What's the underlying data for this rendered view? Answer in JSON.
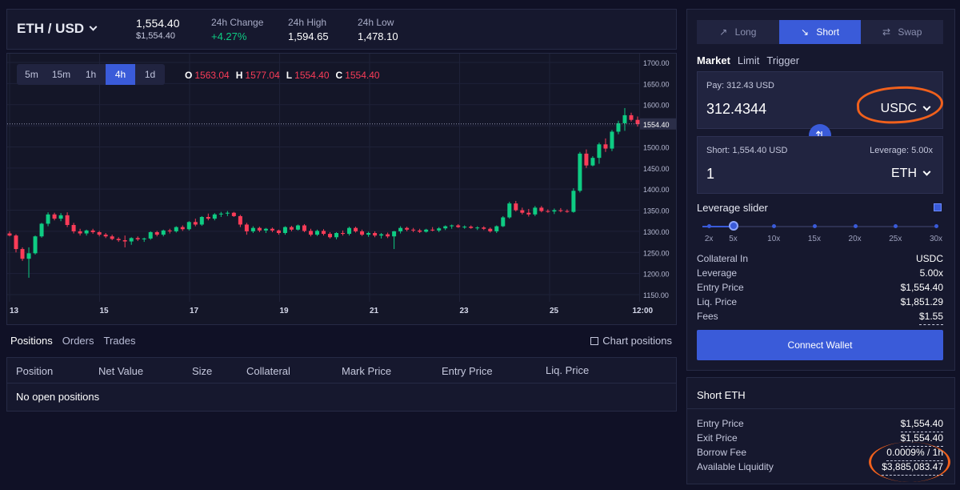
{
  "ticker": {
    "pair": "ETH / USD",
    "price": "1,554.40",
    "price_usd": "$1,554.40",
    "change_label": "24h Change",
    "change_value": "+4.27%",
    "high_label": "24h High",
    "high_value": "1,594.65",
    "low_label": "24h Low",
    "low_value": "1,478.10"
  },
  "chart": {
    "timeframes": [
      "5m",
      "15m",
      "1h",
      "4h",
      "1d"
    ],
    "active_timeframe": "4h",
    "ohlc": {
      "o": "1563.04",
      "h": "1577.04",
      "l": "1554.40",
      "c": "1554.40"
    },
    "ohlc_labels": {
      "o": "O",
      "h": "H",
      "l": "L",
      "c": "C"
    },
    "price_tag": "1554.40"
  },
  "chart_data": {
    "type": "candlestick",
    "x_labels": [
      "13",
      "15",
      "17",
      "19",
      "21",
      "23",
      "25",
      "12:00"
    ],
    "y_ticks": [
      1700,
      1650,
      1600,
      1550,
      1500,
      1450,
      1400,
      1350,
      1300,
      1250,
      1200,
      1150
    ],
    "ylim": [
      1130,
      1715
    ],
    "current_price": 1554.4,
    "colors": {
      "up": "#0ecc83",
      "down": "#fa3c58"
    },
    "candles": [
      [
        1295,
        1300,
        1288,
        1290
      ],
      [
        1290,
        1293,
        1250,
        1258
      ],
      [
        1258,
        1262,
        1230,
        1235
      ],
      [
        1235,
        1262,
        1190,
        1248
      ],
      [
        1248,
        1290,
        1245,
        1288
      ],
      [
        1288,
        1320,
        1285,
        1318
      ],
      [
        1318,
        1345,
        1312,
        1340
      ],
      [
        1340,
        1344,
        1326,
        1330
      ],
      [
        1330,
        1343,
        1324,
        1338
      ],
      [
        1338,
        1345,
        1310,
        1315
      ],
      [
        1315,
        1320,
        1295,
        1300
      ],
      [
        1300,
        1306,
        1290,
        1295
      ],
      [
        1295,
        1304,
        1290,
        1302
      ],
      [
        1302,
        1306,
        1294,
        1298
      ],
      [
        1298,
        1301,
        1288,
        1292
      ],
      [
        1292,
        1296,
        1284,
        1288
      ],
      [
        1288,
        1292,
        1279,
        1282
      ],
      [
        1282,
        1286,
        1275,
        1279
      ],
      [
        1279,
        1290,
        1262,
        1276
      ],
      [
        1276,
        1286,
        1268,
        1284
      ],
      [
        1284,
        1288,
        1277,
        1281
      ],
      [
        1281,
        1285,
        1275,
        1283
      ],
      [
        1283,
        1300,
        1280,
        1298
      ],
      [
        1298,
        1301,
        1288,
        1292
      ],
      [
        1292,
        1304,
        1288,
        1302
      ],
      [
        1302,
        1306,
        1295,
        1300
      ],
      [
        1300,
        1312,
        1297,
        1310
      ],
      [
        1310,
        1314,
        1301,
        1305
      ],
      [
        1305,
        1324,
        1302,
        1322
      ],
      [
        1322,
        1330,
        1312,
        1316
      ],
      [
        1316,
        1336,
        1313,
        1334
      ],
      [
        1334,
        1342,
        1326,
        1330
      ],
      [
        1330,
        1343,
        1326,
        1340
      ],
      [
        1340,
        1346,
        1334,
        1342
      ],
      [
        1342,
        1348,
        1336,
        1344
      ],
      [
        1344,
        1346,
        1334,
        1336
      ],
      [
        1336,
        1339,
        1310,
        1316
      ],
      [
        1316,
        1320,
        1292,
        1300
      ],
      [
        1300,
        1312,
        1296,
        1308
      ],
      [
        1308,
        1311,
        1298,
        1302
      ],
      [
        1302,
        1308,
        1296,
        1306
      ],
      [
        1306,
        1309,
        1298,
        1302
      ],
      [
        1302,
        1304,
        1292,
        1296
      ],
      [
        1296,
        1312,
        1292,
        1310
      ],
      [
        1310,
        1313,
        1300,
        1304
      ],
      [
        1304,
        1316,
        1302,
        1314
      ],
      [
        1314,
        1317,
        1298,
        1301
      ],
      [
        1301,
        1306,
        1288,
        1292
      ],
      [
        1292,
        1304,
        1289,
        1301
      ],
      [
        1301,
        1305,
        1290,
        1294
      ],
      [
        1294,
        1298,
        1283,
        1286
      ],
      [
        1286,
        1298,
        1281,
        1296
      ],
      [
        1296,
        1302,
        1290,
        1294
      ],
      [
        1294,
        1311,
        1290,
        1308
      ],
      [
        1308,
        1311,
        1297,
        1300
      ],
      [
        1300,
        1304,
        1289,
        1292
      ],
      [
        1292,
        1299,
        1287,
        1296
      ],
      [
        1296,
        1300,
        1286,
        1290
      ],
      [
        1290,
        1296,
        1283,
        1293
      ],
      [
        1293,
        1297,
        1284,
        1288
      ],
      [
        1288,
        1301,
        1258,
        1300
      ],
      [
        1300,
        1312,
        1295,
        1308
      ],
      [
        1308,
        1311,
        1300,
        1304
      ],
      [
        1304,
        1308,
        1298,
        1302
      ],
      [
        1302,
        1306,
        1296,
        1299
      ],
      [
        1299,
        1306,
        1297,
        1304
      ],
      [
        1304,
        1310,
        1300,
        1302
      ],
      [
        1302,
        1310,
        1298,
        1307
      ],
      [
        1307,
        1314,
        1303,
        1312
      ],
      [
        1312,
        1316,
        1306,
        1314
      ],
      [
        1314,
        1317,
        1308,
        1310
      ],
      [
        1310,
        1314,
        1306,
        1311
      ],
      [
        1311,
        1314,
        1306,
        1308
      ],
      [
        1308,
        1312,
        1303,
        1309
      ],
      [
        1309,
        1312,
        1303,
        1306
      ],
      [
        1306,
        1309,
        1297,
        1300
      ],
      [
        1300,
        1314,
        1296,
        1312
      ],
      [
        1312,
        1336,
        1310,
        1333
      ],
      [
        1333,
        1370,
        1330,
        1366
      ],
      [
        1366,
        1372,
        1347,
        1350
      ],
      [
        1350,
        1356,
        1340,
        1344
      ],
      [
        1344,
        1353,
        1335,
        1340
      ],
      [
        1340,
        1360,
        1336,
        1356
      ],
      [
        1356,
        1360,
        1345,
        1348
      ],
      [
        1348,
        1352,
        1344,
        1347
      ],
      [
        1347,
        1354,
        1341,
        1350
      ],
      [
        1350,
        1355,
        1345,
        1348
      ],
      [
        1348,
        1352,
        1344,
        1346
      ],
      [
        1346,
        1402,
        1344,
        1396
      ],
      [
        1396,
        1488,
        1392,
        1484
      ],
      [
        1484,
        1494,
        1450,
        1456
      ],
      [
        1456,
        1478,
        1454,
        1474
      ],
      [
        1474,
        1510,
        1460,
        1506
      ],
      [
        1506,
        1520,
        1488,
        1496
      ],
      [
        1496,
        1540,
        1490,
        1536
      ],
      [
        1536,
        1562,
        1530,
        1556
      ],
      [
        1556,
        1592,
        1538,
        1575
      ],
      [
        1575,
        1581,
        1560,
        1564
      ],
      [
        1564,
        1572,
        1548,
        1554
      ]
    ]
  },
  "positions": {
    "tabs": [
      "Positions",
      "Orders",
      "Trades"
    ],
    "chart_positions": "Chart positions",
    "columns": [
      "Position",
      "Net Value",
      "Size",
      "Collateral",
      "Mark Price",
      "Entry Price",
      "Liq. Price"
    ],
    "empty": "No open positions"
  },
  "trade": {
    "modes": [
      "Long",
      "Short",
      "Swap"
    ],
    "active_mode": "Short",
    "mode_icons": [
      "trend-up-icon",
      "trend-down-icon",
      "swap-icon"
    ],
    "order_types": [
      "Market",
      "Limit",
      "Trigger"
    ],
    "pay_label": "Pay: 312.43 USD",
    "pay_value": "312.4344",
    "pay_token": "USDC",
    "short_label": "Short: 1,554.40 USD",
    "leverage_label": "Leverage: 5.00x",
    "short_value": "1",
    "short_token": "ETH",
    "slider_label": "Leverage slider",
    "slider_ticks": [
      "2x",
      "5x",
      "10x",
      "15x",
      "20x",
      "25x",
      "30x"
    ],
    "slider_value": 5,
    "details": [
      {
        "k": "Collateral In",
        "v": "USDC"
      },
      {
        "k": "Leverage",
        "v": "5.00x"
      },
      {
        "k": "Entry Price",
        "v": "$1,554.40"
      },
      {
        "k": "Liq. Price",
        "v": "$1,851.29"
      },
      {
        "k": "Fees",
        "v": "$1.55"
      }
    ],
    "connect": "Connect Wallet"
  },
  "summary": {
    "title": "Short ETH",
    "rows": [
      {
        "k": "Entry Price",
        "v": "$1,554.40"
      },
      {
        "k": "Exit Price",
        "v": "$1,554.40"
      },
      {
        "k": "Borrow Fee",
        "v": "0.0009% / 1h"
      },
      {
        "k": "Available Liquidity",
        "v": "$3,885,083.47"
      }
    ]
  },
  "annotation_color": "#f0601c"
}
